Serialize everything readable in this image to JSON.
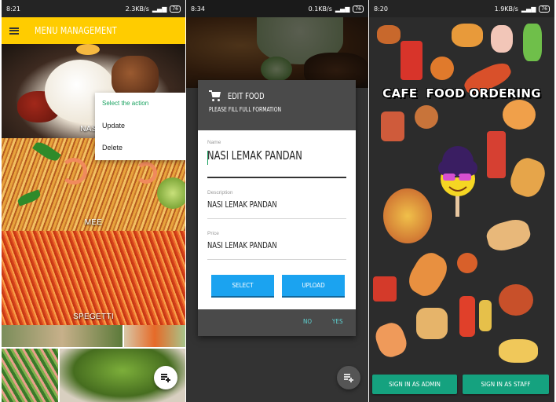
{
  "screen1": {
    "status": {
      "time": "8:21",
      "speed": "2.3KB/s",
      "battery": "76"
    },
    "appbar": {
      "title": "MENU MANAGEMENT"
    },
    "foods": [
      {
        "label": "NASI L"
      },
      {
        "label": "MEE"
      },
      {
        "label": "SPEGETTI"
      }
    ],
    "context_menu": {
      "title": "Select the action",
      "items": [
        "Update",
        "Delete"
      ]
    }
  },
  "screen2": {
    "status": {
      "time": "8:34",
      "speed": "0.1KB/s",
      "battery": "76"
    },
    "dialog": {
      "title": "EDIT FOOD",
      "subtitle": "PLEASE FILL FULL FORMATION",
      "name_label": "Name",
      "name_value": "NASI LEMAK PANDAN",
      "description_label": "Description",
      "description_value": "NASI LEMAK PANDAN",
      "price_label": "Price",
      "price_value": "NASI LEMAK PANDAN",
      "select_label": "SELECT",
      "upload_label": "UPLOAD",
      "no_label": "NO",
      "yes_label": "YES"
    }
  },
  "screen3": {
    "status": {
      "time": "8:20",
      "speed": "1.9KB/s",
      "battery": "76"
    },
    "title": "CAFE  FOOD ORDERING",
    "admin_button": "SIGN IN AS ADMIN",
    "staff_button": "SIGN IN AS STAFF"
  },
  "colors": {
    "appbar": "#ffcc00",
    "accent_green": "#1aa260",
    "dialog_button": "#1ba3f0",
    "dialog_action": "#5fd3d3",
    "splash_button": "#15a27f"
  }
}
